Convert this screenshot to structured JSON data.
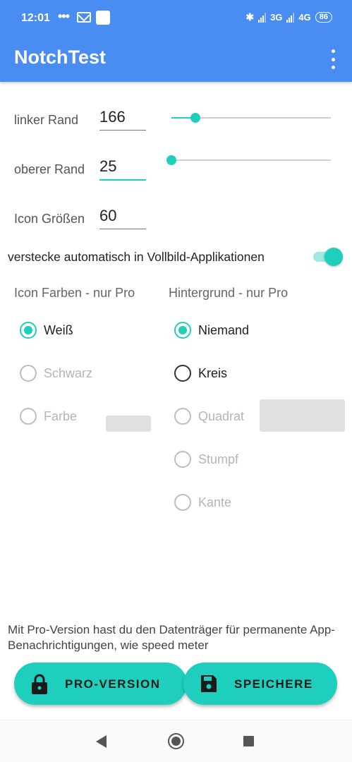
{
  "status_bar": {
    "time": "12:01",
    "dots": "•••",
    "network_1": "3G",
    "network_2": "4G",
    "battery": "86"
  },
  "app_bar": {
    "title": "NotchTest",
    "menu_icon": "more-vert-icon"
  },
  "fields": {
    "left_margin": {
      "label": "linker Rand",
      "value": "166",
      "slider_fraction": 0.15
    },
    "top_margin": {
      "label": "oberer Rand",
      "value": "25",
      "slider_fraction": 0.0
    },
    "icon_size": {
      "label": "Icon Größen",
      "value": "60"
    }
  },
  "auto_hide": {
    "label": "verstecke automatisch in Vollbild-Applikationen",
    "enabled": true
  },
  "icon_colors": {
    "header": "Icon Farben - nur Pro",
    "options": [
      {
        "label": "Weiß",
        "checked": true,
        "enabled": true
      },
      {
        "label": "Schwarz",
        "checked": false,
        "enabled": false
      },
      {
        "label": "Farbe",
        "checked": false,
        "enabled": false
      }
    ]
  },
  "background": {
    "header": "Hintergrund - nur Pro",
    "options": [
      {
        "label": "Niemand",
        "checked": true,
        "enabled": true
      },
      {
        "label": "Kreis",
        "checked": false,
        "enabled": true
      },
      {
        "label": "Quadrat",
        "checked": false,
        "enabled": false
      },
      {
        "label": "Stumpf",
        "checked": false,
        "enabled": false
      },
      {
        "label": "Kante",
        "checked": false,
        "enabled": false
      }
    ]
  },
  "info_text": "Mit Pro-Version hast du den Datenträger für permanente App-Benachrichtigungen, wie speed meter",
  "buttons": {
    "pro": "PRO-VERSION",
    "save": "SPEICHERE"
  },
  "colors": {
    "primary": "#4a8df2",
    "accent": "#1ecfbe"
  }
}
